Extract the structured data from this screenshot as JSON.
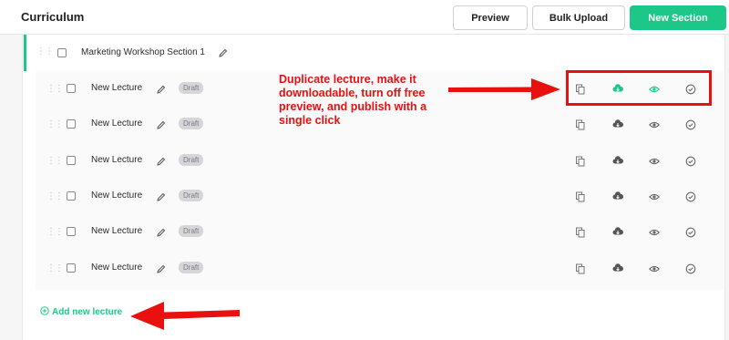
{
  "header": {
    "title": "Curriculum",
    "preview_label": "Preview",
    "bulk_upload_label": "Bulk Upload",
    "new_section_label": "New Section"
  },
  "section": {
    "title": "Marketing Workshop Section 1"
  },
  "lectures": [
    {
      "title": "New Lecture",
      "status": "Draft"
    },
    {
      "title": "New Lecture",
      "status": "Draft"
    },
    {
      "title": "New Lecture",
      "status": "Draft"
    },
    {
      "title": "New Lecture",
      "status": "Draft"
    },
    {
      "title": "New Lecture",
      "status": "Draft"
    },
    {
      "title": "New Lecture",
      "status": "Draft"
    }
  ],
  "lecture_actions": [
    "copy-icon",
    "cloud-download-icon",
    "eye-icon",
    "check-circle-icon"
  ],
  "add_lecture_label": "Add new lecture",
  "annotation": {
    "text": "Duplicate lecture, make it downloadable, turn off free preview, and publish with a single click"
  },
  "colors": {
    "accent": "#1cc788",
    "annotation_red": "#e8110f",
    "badge_bg": "#d6d6da",
    "icon_gray": "#777777"
  }
}
